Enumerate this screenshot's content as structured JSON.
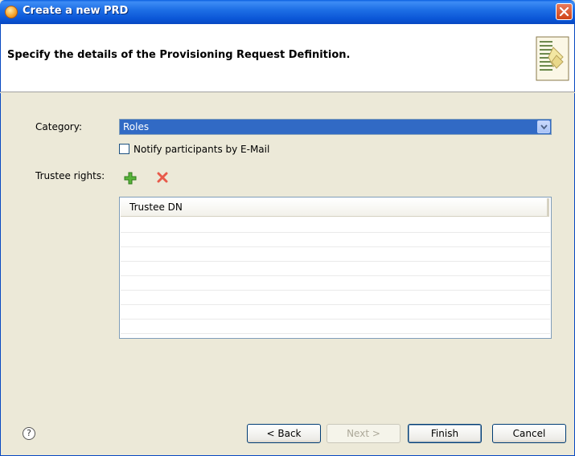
{
  "window": {
    "title": "Create a new PRD"
  },
  "banner": {
    "heading": "Specify the details of the Provisioning Request Definition."
  },
  "form": {
    "category_label": "Category:",
    "category_value": "Roles",
    "notify_label": "Notify participants by E-Mail",
    "notify_checked": false,
    "trustee_label": "Trustee rights:",
    "trustee_table": {
      "columns": [
        "Trustee DN"
      ],
      "rows": []
    }
  },
  "footer": {
    "help_glyph": "?",
    "back_label": "< Back",
    "next_label": "Next >",
    "finish_label": "Finish",
    "cancel_label": "Cancel"
  },
  "colors": {
    "selection": "#316ac5",
    "titlebar": "#0a55d6",
    "dialog_bg": "#ece9d8",
    "add_icon": "#3f9d2b",
    "remove_icon": "#e04a3a"
  }
}
